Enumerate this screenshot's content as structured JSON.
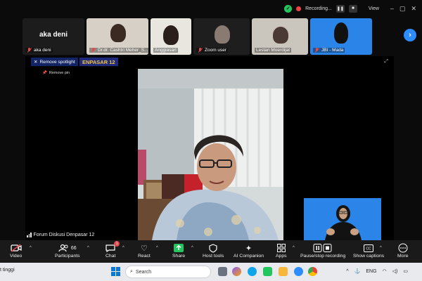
{
  "topbar": {
    "recording_label": "Recording...",
    "view_label": "View"
  },
  "participants_strip": [
    {
      "name": "aka deni",
      "display": "aka deni"
    },
    {
      "name": "Dr.dr. Cashtri Meher_S..."
    },
    {
      "name": "Anggiasari"
    },
    {
      "name": "Zoom user"
    },
    {
      "name": "Lestari Moerdijat"
    },
    {
      "name": "JBI - Mada"
    }
  ],
  "spotlight": {
    "remove_label": "Remove spotlight",
    "banner_text": "ENPASAR 12",
    "remove_pin_label": "Remove pin",
    "meeting_name": "Forum Diskusi Denpasar 12"
  },
  "toolbar": {
    "video": "Video",
    "participants": "Participants",
    "participants_count": "66",
    "chat": "Chat",
    "chat_badge": "1",
    "react": "React",
    "share": "Share",
    "host_tools": "Host tools",
    "ai_companion": "AI Companion",
    "apps": "Apps",
    "pause_stop_recording": "Pause/stop recording",
    "show_captions": "Show captions",
    "more": "More"
  },
  "taskbar": {
    "left_text": "t tinggi",
    "search_placeholder": "Search",
    "language": "ENG"
  },
  "colors": {
    "accent_blue": "#2d8cff",
    "share_green": "#22c55e",
    "muted_red": "#e5484d",
    "banner_yellow": "#f5c542"
  }
}
